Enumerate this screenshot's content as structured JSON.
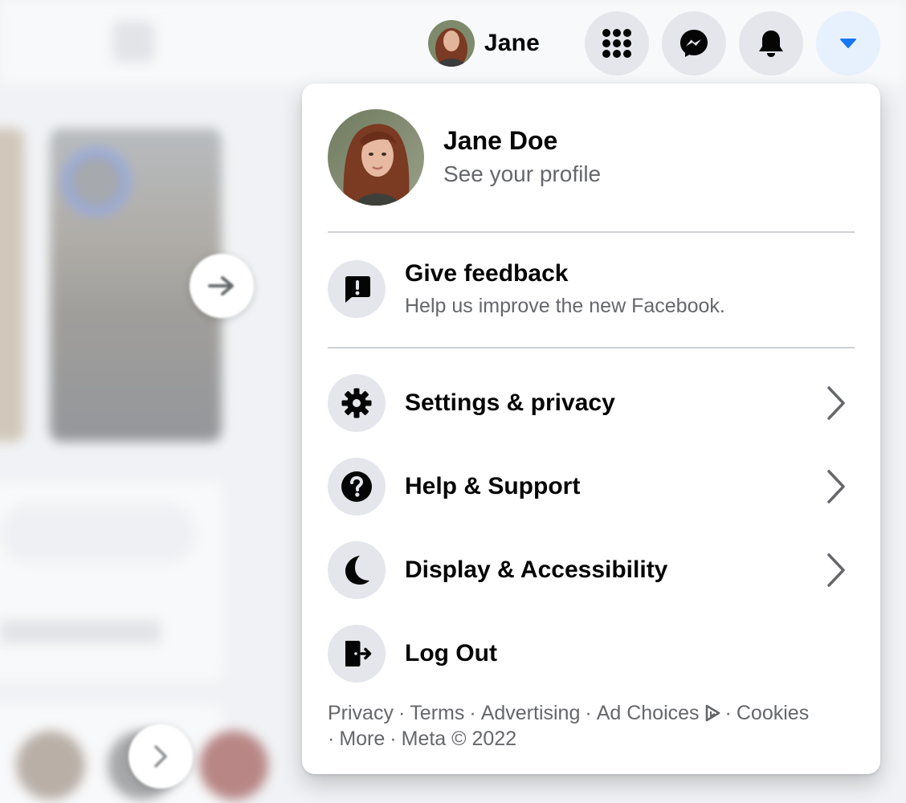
{
  "user": {
    "short_name": "Jane",
    "full_name": "Jane Doe",
    "profile_link": "See your profile"
  },
  "topbar": {
    "icons": [
      "menu-grid-icon",
      "messenger-icon",
      "bell-icon",
      "caret-down-icon"
    ],
    "accent": "#1877f2"
  },
  "menu": {
    "feedback": {
      "label": "Give feedback",
      "sublabel": "Help us improve the new Facebook."
    },
    "items": [
      {
        "label": "Settings & privacy",
        "icon": "gear-icon",
        "has_submenu": true
      },
      {
        "label": "Help & Support",
        "icon": "question-icon",
        "has_submenu": true
      },
      {
        "label": "Display & Accessibility",
        "icon": "moon-icon",
        "has_submenu": true
      },
      {
        "label": "Log Out",
        "icon": "logout-icon",
        "has_submenu": false
      }
    ]
  },
  "footer": {
    "links": [
      "Privacy",
      "Terms",
      "Advertising",
      "Ad Choices",
      "Cookies",
      "More"
    ],
    "separator": "·",
    "copyright": "Meta © 2022"
  },
  "colors": {
    "secondary_text": "#65676b",
    "icon_bg": "#e4e6eb",
    "active_btn_bg": "#e7f0fd",
    "divider": "#ced0d4"
  }
}
